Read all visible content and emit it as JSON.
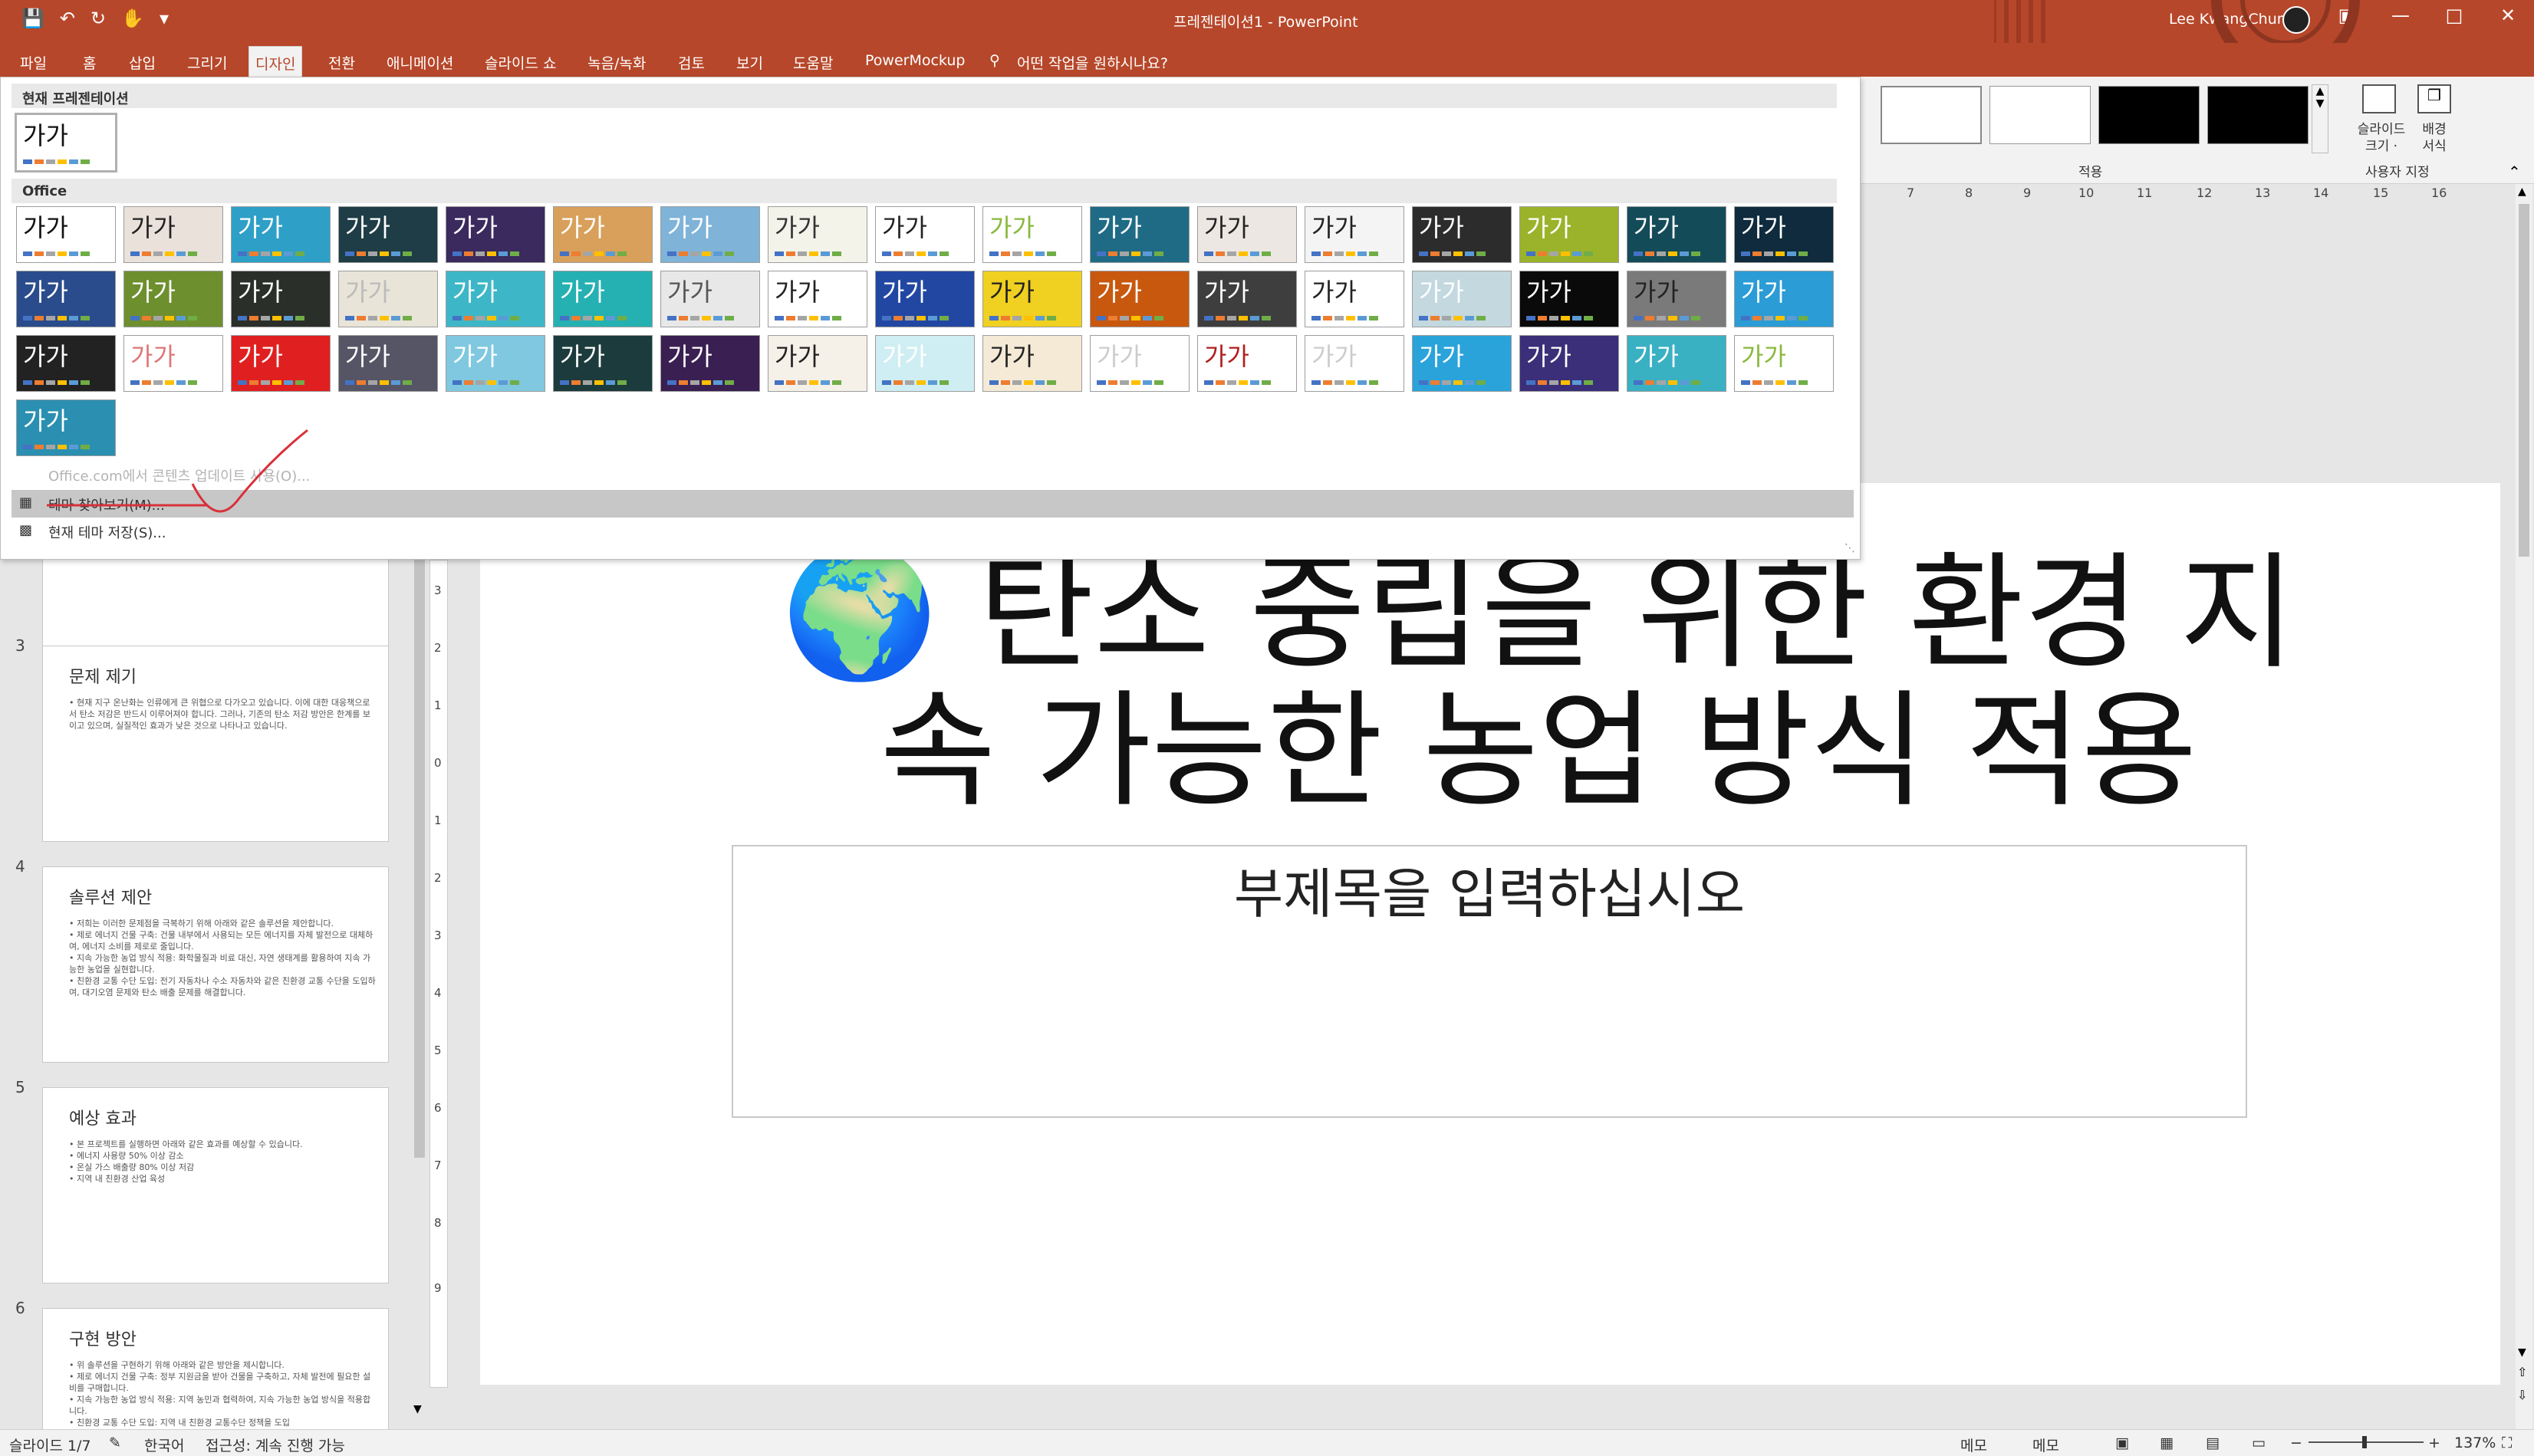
{
  "window": {
    "title": "프레젠테이션1  -  PowerPoint",
    "user": "Lee KwangChun"
  },
  "quick_access": [
    "save-icon",
    "undo-icon",
    "redo-icon",
    "touch-mode-icon",
    "customize-icon"
  ],
  "tabs": [
    "파일",
    "홈",
    "삽입",
    "그리기",
    "디자인",
    "전환",
    "애니메이션",
    "슬라이드 쇼",
    "녹음/녹화",
    "검토",
    "보기",
    "도움말",
    "PowerMockup"
  ],
  "active_tab": "디자인",
  "tell_me": "어떤 작업을 원하시나요?",
  "ribbon": {
    "variants_label": "적용",
    "slide_size": "슬라이드\n크기 ·",
    "format_bg": "배경\n서식",
    "customize_label": "사용자 지정"
  },
  "dropdown": {
    "current_section": "현재 프레젠테이션",
    "office_section": "Office",
    "theme_glyph": "가가",
    "menu": {
      "update": "Office.com에서 콘텐츠 업데이트 사용(O)...",
      "browse": "테마 찾아보기(M)...",
      "save": "현재 테마 저장(S)..."
    }
  },
  "ruler_numbers": [
    "7",
    "8",
    "9",
    "10",
    "11",
    "12",
    "13",
    "14",
    "15",
    "16"
  ],
  "vertical_ruler": [
    "3",
    "2",
    "1",
    "0",
    "1",
    "2",
    "3",
    "4",
    "5",
    "6",
    "7",
    "8",
    "9"
  ],
  "slides": [
    {
      "num": "3",
      "title": "문제 제기",
      "body": "• 현재 지구 온난화는 인류에게 큰 위협으로 다가오고 있습니다. 이에 대한 대응책으로서 탄소 저감은 반드시 이루어져야 합니다. 그러나, 기존의 탄소 저감 방안은 한계를 보이고 있으며, 실질적인 효과가 낮은 것으로 나타나고 있습니다."
    },
    {
      "num": "4",
      "title": "솔루션 제안",
      "body": "• 저희는 이러한 문제점을 극복하기 위해 아래와 같은 솔루션을 제안합니다.\n• 제로 에너지 건물 구축: 건물 내부에서 사용되는 모든 에너지를 자체 발전으로 대체하여, 에너지 소비를 제로로 줄입니다.\n• 지속 가능한 농업 방식 적용: 화학물질과 비료 대신, 자연 생태계를 활용하여 지속 가능한 농업을 실현합니다.\n• 친환경 교통 수단 도입: 전기 자동차나 수소 자동차와 같은 친환경 교통 수단을 도입하여, 대기오염 문제와 탄소 배출 문제를 해결합니다."
    },
    {
      "num": "5",
      "title": "예상 효과",
      "body": "• 본 프로젝트를 실행하면 아래와 같은 효과를 예상할 수 있습니다.\n• 에너지 사용량 50% 이상 감소\n• 온실 가스 배출량 80% 이상 저감\n• 지역 내 친환경 산업 육성"
    },
    {
      "num": "6",
      "title": "구현 방안",
      "body": "• 위 솔루션을 구현하기 위해 아래와 같은 방안을 제시합니다.\n• 제로 에너지 건물 구축: 정부 지원금을 받아 건물을 구축하고, 자체 발전에 필요한 설비를 구매합니다.\n• 지속 가능한 농업 방식 적용: 지역 농민과 협력하여, 지속 가능한 농업 방식을 적용합니다.\n• 친환경 교통 수단 도입: 지역 내 친환경 교통수단 정책을 도입"
    }
  ],
  "main_slide": {
    "title": "🌍 탄소 중립을 위한 환경 지속 가능한 농업 방식 적용",
    "subtitle": "부제목을 입력하십시오"
  },
  "status": {
    "slide": "슬라이드 1/7",
    "language": "한국어",
    "accessibility": "접근성: 계속 진행 가능",
    "notes": "메모",
    "comments": "메모",
    "zoom": "137%"
  },
  "colors": {
    "accent": "#b7472a",
    "check": "#d9303a"
  }
}
